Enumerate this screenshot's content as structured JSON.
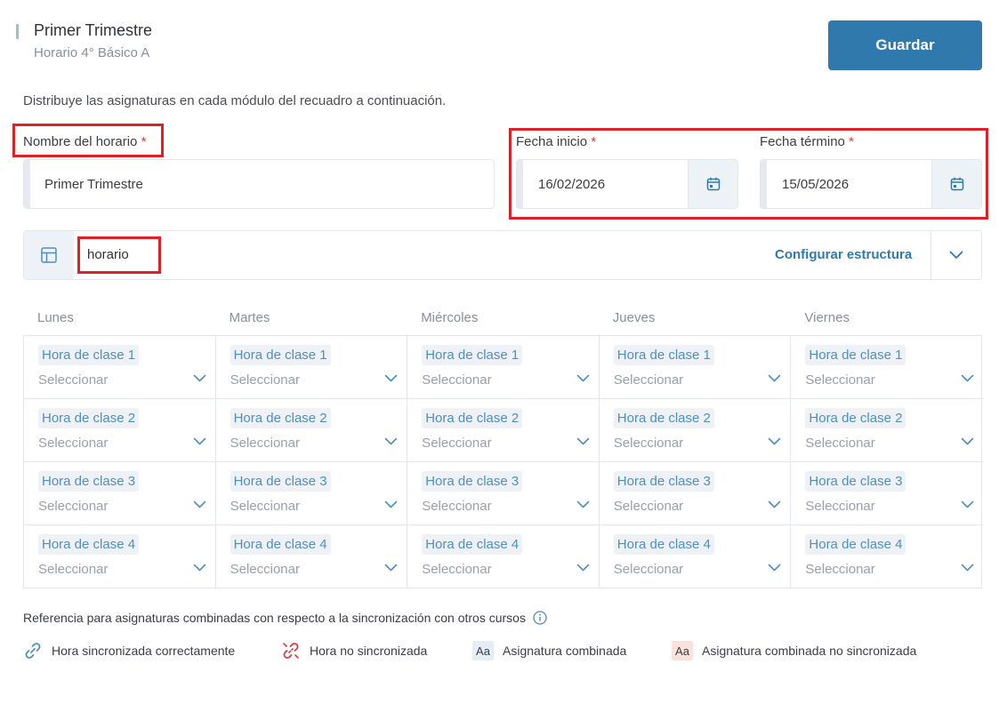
{
  "header": {
    "title": "Primer Trimestre",
    "subtitle": "Horario 4° Básico A",
    "save_label": "Guardar"
  },
  "instructions": "Distribuye las asignaturas en cada módulo del recuadro a continuación.",
  "form": {
    "name_label": "Nombre del horario",
    "required_mark": "*",
    "name_value": "Primer Trimestre",
    "start_label": "Fecha inicio",
    "start_value": "16/02/2026",
    "end_label": "Fecha término",
    "end_value": "15/05/2026"
  },
  "template": {
    "name": "horario",
    "configure_label": "Configurar estructura"
  },
  "schedule": {
    "days": [
      "Lunes",
      "Martes",
      "Miércoles",
      "Jueves",
      "Viernes"
    ],
    "slots": [
      "Hora de clase 1",
      "Hora de clase 2",
      "Hora de clase 3",
      "Hora de clase 4"
    ],
    "select_placeholder": "Seleccionar"
  },
  "legend": {
    "title": "Referencia para asignaturas combinadas con respecto a la sincronización con otros cursos",
    "items": [
      {
        "icon": "link-icon",
        "label": "Hora sincronizada correctamente"
      },
      {
        "icon": "broken-link-icon",
        "label": "Hora no sincronizada"
      },
      {
        "icon": "aa-badge",
        "badge": "Aa",
        "label": "Asignatura combinada"
      },
      {
        "icon": "aa-badge-warning",
        "badge": "Aa",
        "label": "Asignatura combinada no sincronizada"
      }
    ]
  },
  "colors": {
    "primary": "#2f79ad",
    "required": "#e0393e",
    "annotation_red": "#e11f26",
    "tag_text": "#4f8fc0",
    "sync_ok": "#4f8fc0",
    "sync_error": "#e0393e",
    "badge_combined_bg": "#e6eef5",
    "badge_unsynced_bg": "#fbe3dc"
  }
}
